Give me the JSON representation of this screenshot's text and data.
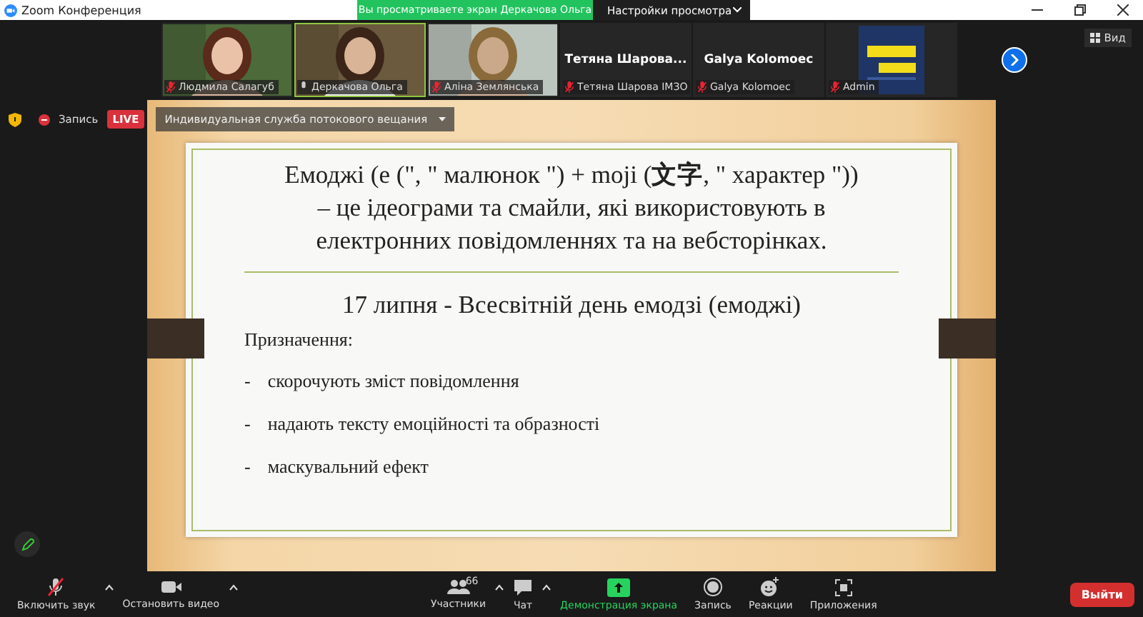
{
  "window": {
    "title": "Zoom Конференция"
  },
  "banner": {
    "viewing": "Вы просматриваете экран Деркачова Ольга",
    "view_settings": "Настройки просмотра"
  },
  "participants": [
    {
      "kind": "video",
      "name": "Людмила Салагуб",
      "muted": true,
      "speaking": false
    },
    {
      "kind": "video",
      "name": "Деркачова Ольга",
      "muted": false,
      "speaking": true
    },
    {
      "kind": "video",
      "name": "Аліна Землянська",
      "muted": true,
      "speaking": false
    },
    {
      "kind": "name",
      "display": "Тетяна Шарова...",
      "name": "Тетяна Шарова ІМЗО",
      "muted": true,
      "speaking": false
    },
    {
      "kind": "name",
      "display": "Galya Kolomoec",
      "name": "Galya Kolomoec",
      "muted": true,
      "speaking": false
    },
    {
      "kind": "logo",
      "name": "Admin",
      "muted": true,
      "speaking": false
    }
  ],
  "view_button": "Вид",
  "recording": {
    "label": "Запись",
    "live": "LIVE",
    "stream": "Индивидуальная служба потокового вещания"
  },
  "slide": {
    "definition": "Емоджі (е (\", \" малюнок \") + moji (**文字**, \" характер \")) – це ідеограми та смайли, які використовують в електронних повідомленнях та на вебсторінках.",
    "date_line": "17 липня - Всесвітній день емодзі (емоджі)",
    "heading": "Призначення:",
    "bullets": [
      {
        "mark": "-",
        "text": "скорочують зміст повідомлення"
      },
      {
        "mark": "-",
        "text": "надають тексту емоційності та образності"
      },
      {
        "mark": "-",
        "text": "маскувальний ефект"
      }
    ]
  },
  "toolbar": [
    {
      "kind": "mic",
      "label": "Включить звук",
      "caret": true,
      "active": false
    },
    {
      "kind": "video",
      "label": "Остановить видео",
      "caret": true,
      "active": false
    },
    {
      "kind": "spacer"
    },
    {
      "kind": "participants",
      "label": "Участники",
      "count": "66",
      "caret": true,
      "active": false
    },
    {
      "kind": "chat",
      "label": "Чат",
      "caret": true,
      "active": false
    },
    {
      "kind": "share",
      "label": "Демонстрация экрана",
      "caret": false,
      "active": true
    },
    {
      "kind": "record",
      "label": "Запись",
      "caret": false,
      "active": false
    },
    {
      "kind": "reactions",
      "label": "Реакции",
      "caret": false,
      "active": false
    },
    {
      "kind": "apps",
      "label": "Приложения",
      "caret": false,
      "active": false
    },
    {
      "kind": "spacer"
    }
  ],
  "leave": "Выйти"
}
